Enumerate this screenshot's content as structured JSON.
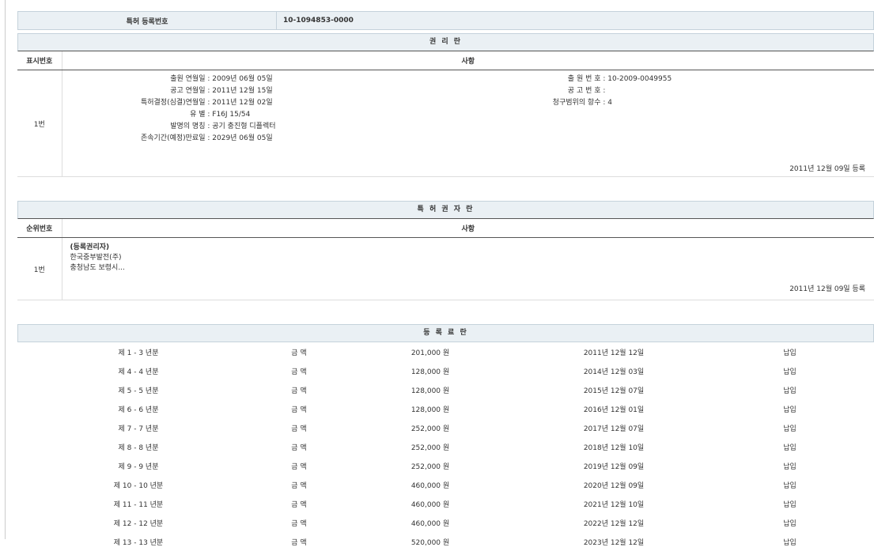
{
  "patent": {
    "label": "특허 등록번호",
    "value": "10-1094853-0000"
  },
  "rights": {
    "title": "권 리 란",
    "col_index": "표시번호",
    "col_matter": "사항",
    "row_index": "1번",
    "left": [
      {
        "label": "출원 연월일",
        "value": "2009년 06월 05일"
      },
      {
        "label": "공고 연월일",
        "value": "2011년 12월 15일"
      },
      {
        "label": "특허결정(심결)연월일",
        "value": "2011년 12월 02일"
      },
      {
        "label": "유 별",
        "value": "F16J 15/54"
      },
      {
        "label": "발명의 명칭",
        "value": "공기 충진형 디플렉터"
      },
      {
        "label": "존속기간(예정)만료일",
        "value": "2029년 06월 05일"
      }
    ],
    "right": [
      {
        "label": "출 원 번 호",
        "value": "10-2009-0049955"
      },
      {
        "label": "공 고 번 호",
        "value": ""
      },
      {
        "label": "청구범위의 항수",
        "value": "4"
      }
    ],
    "registered": "2011년 12월 09일 등록"
  },
  "holder": {
    "title": "특 허 권 자 란",
    "col_index": "순위번호",
    "col_matter": "사항",
    "row_index": "1번",
    "lines": [
      "(등록권리자)",
      "한국중부발전(주)",
      "충청남도 보령시..."
    ],
    "registered": "2011년 12월 09일 등록"
  },
  "fees": {
    "title": "등 록 료 란",
    "rows": [
      {
        "period": "제 1 - 3 년분",
        "amount_label": "금 액",
        "amount": "201,000 원",
        "date": "2011년 12월 12일",
        "status": "납입"
      },
      {
        "period": "제 4 - 4 년분",
        "amount_label": "금 액",
        "amount": "128,000 원",
        "date": "2014년 12월 03일",
        "status": "납입"
      },
      {
        "period": "제 5 - 5 년분",
        "amount_label": "금 액",
        "amount": "128,000 원",
        "date": "2015년 12월 07일",
        "status": "납입"
      },
      {
        "period": "제 6 - 6 년분",
        "amount_label": "금 액",
        "amount": "128,000 원",
        "date": "2016년 12월 01일",
        "status": "납입"
      },
      {
        "period": "제 7 - 7 년분",
        "amount_label": "금 액",
        "amount": "252,000 원",
        "date": "2017년 12월 07일",
        "status": "납입"
      },
      {
        "period": "제 8 - 8 년분",
        "amount_label": "금 액",
        "amount": "252,000 원",
        "date": "2018년 12월 10일",
        "status": "납입"
      },
      {
        "period": "제 9 - 9 년분",
        "amount_label": "금 액",
        "amount": "252,000 원",
        "date": "2019년 12월 09일",
        "status": "납입"
      },
      {
        "period": "제 10 - 10 년분",
        "amount_label": "금 액",
        "amount": "460,000 원",
        "date": "2020년 12월 09일",
        "status": "납입"
      },
      {
        "period": "제 11 - 11 년분",
        "amount_label": "금 액",
        "amount": "460,000 원",
        "date": "2021년 12월 10일",
        "status": "납입"
      },
      {
        "period": "제 12 - 12 년분",
        "amount_label": "금 액",
        "amount": "460,000 원",
        "date": "2022년 12월 12일",
        "status": "납입"
      },
      {
        "period": "제 13 - 13 년분",
        "amount_label": "금 액",
        "amount": "520,000 원",
        "date": "2023년 12월 12일",
        "status": "납입"
      }
    ]
  }
}
